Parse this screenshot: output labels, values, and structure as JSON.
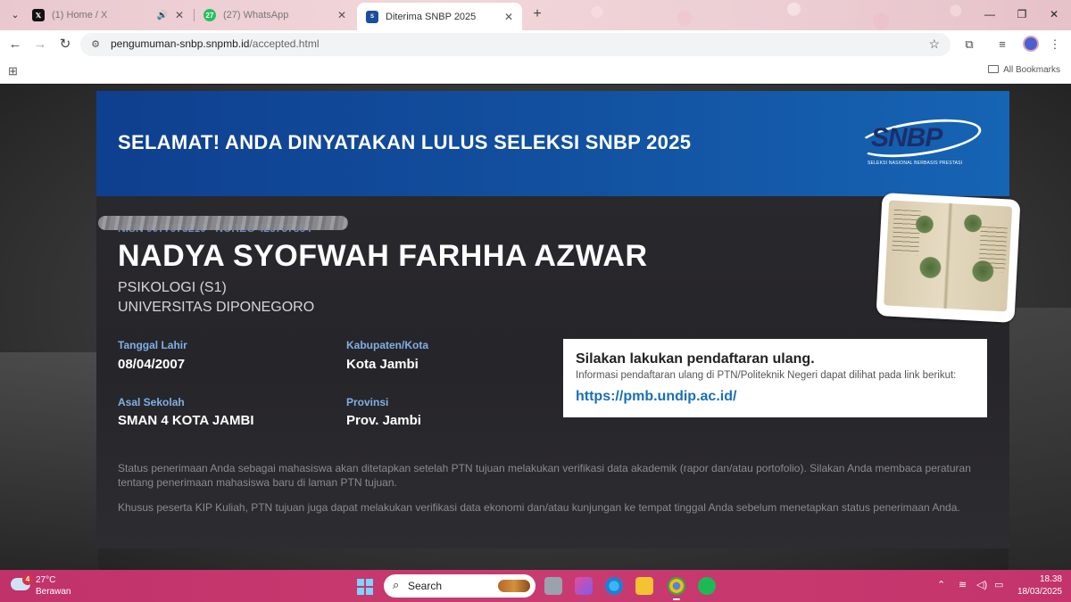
{
  "browser": {
    "tabs": [
      {
        "title": "(1) Home / X",
        "favicon": "x-logo-icon",
        "extra": "🔊",
        "active": false
      },
      {
        "title": "(27) WhatsApp",
        "favicon": "whatsapp-icon",
        "badge": "27",
        "active": false
      },
      {
        "title": "Diterima SNBP 2025",
        "favicon": "snbp-favicon",
        "active": true
      }
    ],
    "url_host": "pengumuman-snbp.snpmb.id",
    "url_path": "/accepted.html",
    "bookmarks": {
      "all_label": "All Bookmarks"
    },
    "accent": "#eac9cf"
  },
  "page": {
    "banner_title": "SELAMAT! ANDA DINYATAKAN LULUS SELEKSI SNBP 2025",
    "logo_text": "SNBP",
    "logo_subtitle": "SELEKSI NASIONAL BERBASIS PRESTASI",
    "nisn_partial": "NISN 0077973210 - NOREG 425737864",
    "name": "NADYA SYOFWAH FARHHA AZWAR",
    "program": "PSIKOLOGI (S1)",
    "university": "UNIVERSITAS DIPONEGORO",
    "fields": {
      "birth_label": "Tanggal Lahir",
      "birth_value": "08/04/2007",
      "city_label": "Kabupaten/Kota",
      "city_value": "Kota Jambi",
      "school_label": "Asal Sekolah",
      "school_value": "SMAN 4 KOTA JAMBI",
      "province_label": "Provinsi",
      "province_value": "Prov. Jambi"
    },
    "info_box": {
      "title": "Silakan lakukan pendaftaran ulang.",
      "description": "Informasi pendaftaran ulang di PTN/Politeknik Negeri dapat dilihat pada link berikut:",
      "link": "https://pmb.undip.ac.id/"
    },
    "note_1": "Status penerimaan Anda sebagai mahasiswa akan ditetapkan setelah PTN tujuan melakukan verifikasi data akademik (rapor dan/atau portofolio). Silakan Anda membaca peraturan tentang penerimaan mahasiswa baru di laman PTN tujuan.",
    "note_2": "Khusus peserta KIP Kuliah, PTN tujuan juga dapat melakukan verifikasi data ekonomi dan/atau kunjungan ke tempat tinggal Anda sebelum menetapkan status penerimaan Anda.",
    "colors": {
      "banner": "#1254a3",
      "label": "#7fb0e6",
      "link": "#1a6fb5"
    }
  },
  "taskbar": {
    "weather_badge": "4",
    "temperature": "27°C",
    "condition": "Berawan",
    "search_placeholder": "Search",
    "time": "18.38",
    "date": "18/03/2025",
    "accent": "#c5366d"
  }
}
